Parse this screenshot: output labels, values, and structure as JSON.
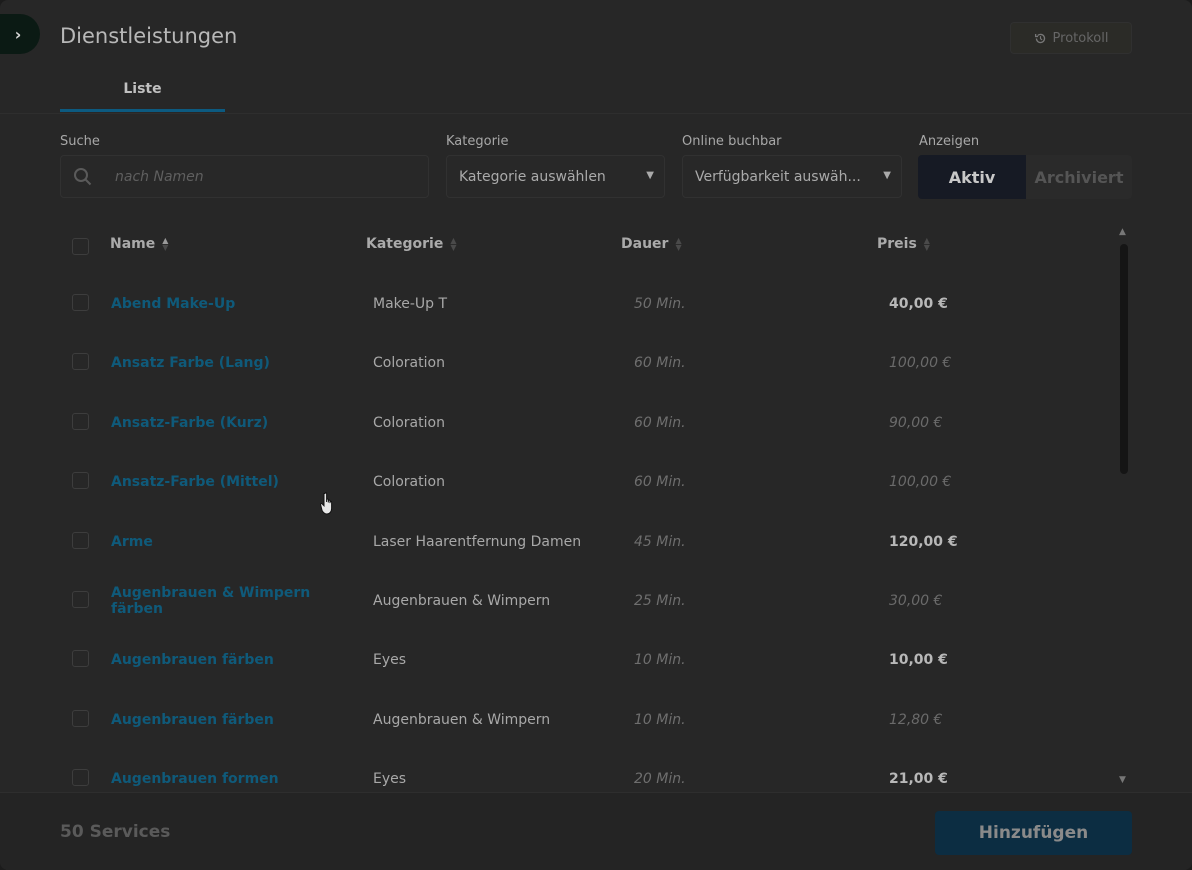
{
  "header": {
    "expand_icon": "chevron-right-icon",
    "title": "Dienstleistungen",
    "protocol_label": "Protokoll",
    "protocol_icon": "history-icon"
  },
  "tabs": [
    {
      "label": "Liste",
      "active": true
    }
  ],
  "filters": {
    "search": {
      "label": "Suche",
      "placeholder": "nach Namen"
    },
    "category": {
      "label": "Kategorie",
      "value": "Kategorie auswählen"
    },
    "online": {
      "label": "Online buchbar",
      "value": "Verfügbarkeit auswäh..."
    },
    "show": {
      "label": "Anzeigen",
      "options": [
        "Aktiv",
        "Archiviert"
      ],
      "selected": "Aktiv"
    }
  },
  "table": {
    "columns": {
      "name": "Name",
      "category": "Kategorie",
      "duration": "Dauer",
      "price": "Preis"
    },
    "rows": [
      {
        "name": "Abend Make-Up",
        "category": "Make-Up T",
        "duration": "50 Min.",
        "price": "40,00 €",
        "price_style": "bold"
      },
      {
        "name": "Ansatz Farbe (Lang)",
        "category": "Coloration",
        "duration": "60 Min.",
        "price": "100,00 €",
        "price_style": "italic"
      },
      {
        "name": "Ansatz-Farbe (Kurz)",
        "category": "Coloration",
        "duration": "60 Min.",
        "price": "90,00 €",
        "price_style": "italic"
      },
      {
        "name": "Ansatz-Farbe (Mittel)",
        "category": "Coloration",
        "duration": "60 Min.",
        "price": "100,00 €",
        "price_style": "italic"
      },
      {
        "name": "Arme",
        "category": "Laser Haarentfernung Damen",
        "duration": "45 Min.",
        "price": "120,00 €",
        "price_style": "bold"
      },
      {
        "name": "Augenbrauen & Wimpern färben",
        "category": "Augenbrauen & Wimpern",
        "duration": "25 Min.",
        "price": "30,00 €",
        "price_style": "italic"
      },
      {
        "name": "Augenbrauen färben",
        "category": "Eyes",
        "duration": "10 Min.",
        "price": "10,00 €",
        "price_style": "bold"
      },
      {
        "name": "Augenbrauen färben",
        "category": "Augenbrauen & Wimpern",
        "duration": "10 Min.",
        "price": "12,80 €",
        "price_style": "italic"
      },
      {
        "name": "Augenbrauen formen",
        "category": "Eyes",
        "duration": "20 Min.",
        "price": "21,00 €",
        "price_style": "bold"
      }
    ]
  },
  "footer": {
    "count": "50 Services",
    "add_label": "Hinzufügen"
  },
  "colors": {
    "link": "#0f5a7a",
    "tab_underline": "#0c5a80",
    "primary_button": "#0c2d42"
  }
}
